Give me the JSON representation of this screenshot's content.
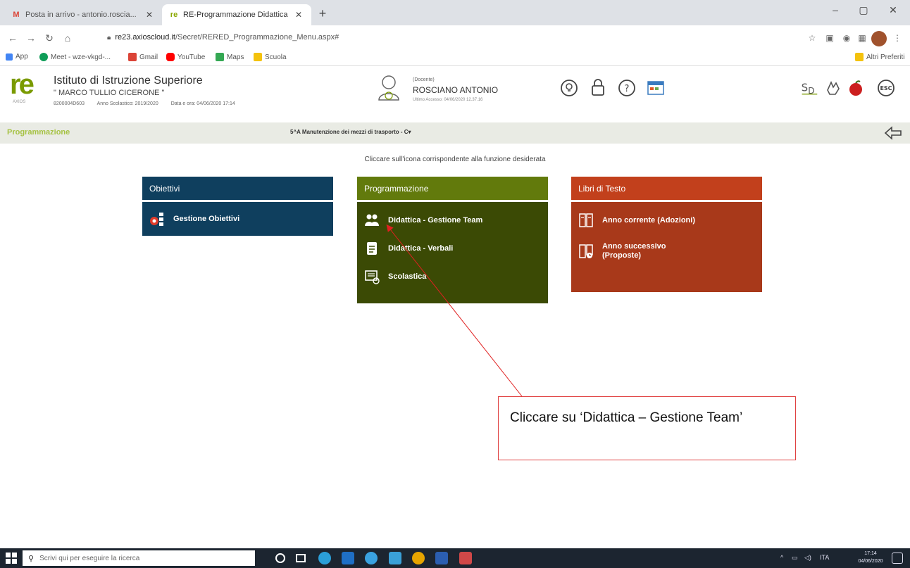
{
  "browser": {
    "tabs": [
      {
        "title": "Posta in arrivo - antonio.roscia...",
        "icon": "gmail-icon",
        "active": false
      },
      {
        "title": "RE-Programmazione Didattica",
        "icon": "argo-icon",
        "active": true
      }
    ],
    "url_domain": "re23.axioscloud.it",
    "url_path": "/Secret/RERED_Programmazione_Menu.aspx#",
    "bookmarks": [
      {
        "label": "App",
        "color": "#4285f4"
      },
      {
        "label": "Meet - wze-vkgd-...",
        "color": "#0f9d58"
      },
      {
        "label": "Gmail",
        "color": "#db4437"
      },
      {
        "label": "YouTube",
        "color": "#ff0000"
      },
      {
        "label": "Maps",
        "color": "#34a853"
      },
      {
        "label": "Scuola",
        "color": "#f4c20d"
      }
    ],
    "other_bookmarks": "Altri Preferiti"
  },
  "header": {
    "logo": "re",
    "logo_sub": "AXIOS",
    "institute_title": "Istituto di Istruzione Superiore",
    "institute_name": "\" MARCO TULLIO CICERONE \"",
    "code": "8200004D603",
    "school_year": "Anno Scolastico: 2019/2020",
    "date_now": "Data e ora: 04/06/2020 17:14",
    "user_role": "(Docente)",
    "user_name": "ROSCIANO ANTONIO",
    "last_access": "Ultimo Accesso: 04/06/2020 12.37.16"
  },
  "module": {
    "title": "Programmazione",
    "class_selector": "5^A Manutenzione dei mezzi di trasporto - C▾"
  },
  "instructions": "Cliccare sull'icona corrispondente alla funzione desiderata",
  "panels": {
    "obiettivi": {
      "title": "Obiettivi",
      "items": [
        "Gestione Obiettivi"
      ]
    },
    "programmazione": {
      "title": "Programmazione",
      "items": [
        "Didattica - Gestione Team",
        "Didattica - Verbali",
        "Scolastica"
      ]
    },
    "libri": {
      "title": "Libri di Testo",
      "items": [
        "Anno corrente (Adozioni)",
        "Anno successivo (Proposte)"
      ]
    }
  },
  "callout": {
    "text": "Cliccare su ‘Didattica – Gestione Team’"
  },
  "taskbar": {
    "search_placeholder": "Scrivi qui per eseguire la ricerca",
    "lang": "ITA",
    "time": "17:14",
    "date": "04/06/2020"
  },
  "colors": {
    "obiettivi": "#0f3f5e",
    "programmazione_head": "#627a0c",
    "programmazione_body": "#3b4a05",
    "libri": "#a8391a",
    "callout_border": "#e04040"
  }
}
